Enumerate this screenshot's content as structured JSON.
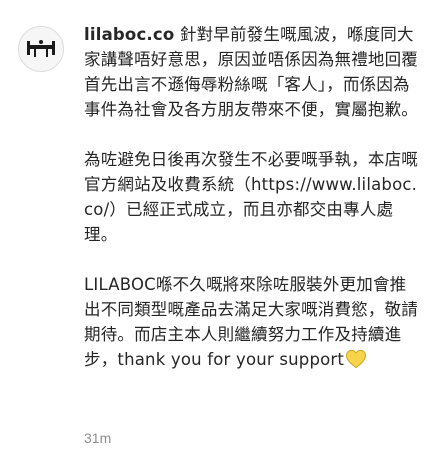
{
  "comment": {
    "avatar_icon": "lilaboc-logo-avatar",
    "username": "lilaboc.co",
    "paragraphs": [
      " 針對早前發生嘅風波，喺度同大家講聲唔好意思，原因並唔係因為無禮地回覆首先出言不遜侮辱粉絲嘅「客人」，而係因為事件為社會及各方朋友帶來不便，實屬抱歉。",
      "為咗避免日後再次發生不必要嘅爭執，本店嘅官方網站及收費系統（https://www.lilaboc.co/）已經正式成立，而且亦都交由專人處理。",
      "LILABOC喺不久嘅將來除咗服裝外更加會推出不同類型嘅產品去滿足大家嘅消費慾，敬請期待。而店主本人則繼續努力工作及持續進步，thank you for your support"
    ],
    "emoji_icon": "yellow-heart-icon",
    "timestamp": "31m",
    "colors": {
      "text": "#262626",
      "meta": "#8e8e8e",
      "heart": "#f7d44c"
    }
  }
}
